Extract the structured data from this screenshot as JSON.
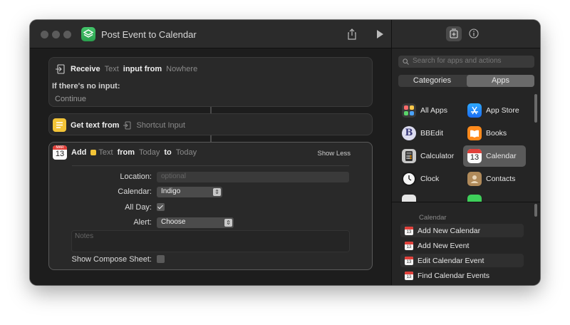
{
  "window": {
    "title": "Post Event to Calendar"
  },
  "actions": {
    "receive": {
      "verb": "Receive",
      "type_token": "Text",
      "mid": "input from",
      "source_token": "Nowhere",
      "no_input_label": "If there's no input:",
      "no_input_value": "Continue"
    },
    "get_text": {
      "verb": "Get text from",
      "source_token": "Shortcut Input"
    },
    "add_event": {
      "calendar_icon_month": "MAR",
      "calendar_icon_day": "13",
      "verb": "Add",
      "type_token": "Text",
      "from_label": "from",
      "from_token": "Today",
      "to_label": "to",
      "to_token": "Today",
      "show_less": "Show Less",
      "location_label": "Location:",
      "location_placeholder": "optional",
      "calendar_label": "Calendar:",
      "calendar_value": "Indigo",
      "allday_label": "All Day:",
      "allday_checked": true,
      "alert_label": "Alert:",
      "alert_value": "Choose",
      "notes_placeholder": "Notes",
      "compose_label": "Show Compose Sheet:",
      "compose_checked": false
    }
  },
  "sidebar": {
    "search_placeholder": "Search for apps and actions",
    "segments": [
      "Categories",
      "Apps"
    ],
    "active_segment": "Apps",
    "apps": [
      {
        "name": "All Apps",
        "icon": "grid-apps-icon"
      },
      {
        "name": "App Store",
        "icon": "app-store-icon"
      },
      {
        "name": "BBEdit",
        "icon": "bbedit-icon"
      },
      {
        "name": "Books",
        "icon": "books-icon"
      },
      {
        "name": "Calculator",
        "icon": "calculator-icon"
      },
      {
        "name": "Calendar",
        "icon": "calendar-icon"
      },
      {
        "name": "Clock",
        "icon": "clock-icon"
      },
      {
        "name": "Contacts",
        "icon": "contacts-icon"
      }
    ],
    "selected_app": "Calendar",
    "section_title": "Calendar",
    "section_actions": [
      "Add New Calendar",
      "Add New Event",
      "Edit Calendar Event",
      "Find Calendar Events"
    ]
  },
  "colors": {
    "window_bg": "#1e1e1e",
    "card_bg": "#292929",
    "app_icon": "#2fb15a",
    "calendar_red": "#e0403a",
    "token_yellow": "#f3c437"
  }
}
